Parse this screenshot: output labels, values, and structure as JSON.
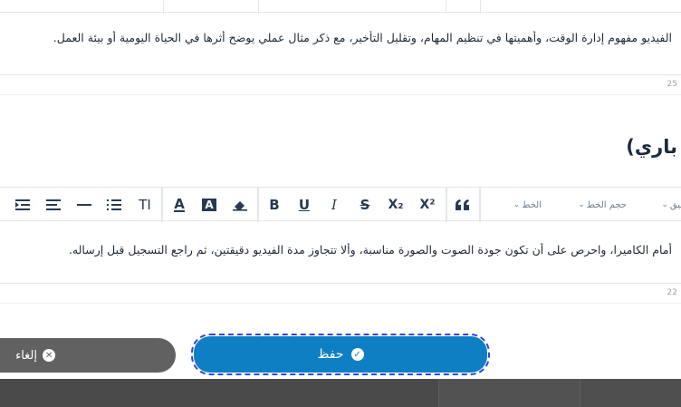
{
  "editor_top": {
    "text": "الفيديو مفهوم إدارة الوقت، وأهميتها في تنظيم المهام، وتقليل التأخير، مع ذكر مثال عملي يوضح أثرها في الحياة اليومية أو بيئة العمل.",
    "char_count": "25"
  },
  "section": {
    "title": "باري)"
  },
  "toolbar": {
    "format_dropdown": "تنسيق",
    "font_size_dropdown": "حجم الخط",
    "font_dropdown": "الخط",
    "quote_icon": "quote-icon",
    "superscript_label": "X²",
    "subscript_label": "X₂",
    "strike_label": "S",
    "italic_label": "I",
    "underline_label": "U",
    "bold_label": "B",
    "eraser_icon": "eraser-icon",
    "highlight_label": "A",
    "text_color_label": "A",
    "text_size_label": "TI"
  },
  "editor_bottom": {
    "text": "أمام الكاميرا، واحرص على أن تكون جودة الصوت والصورة مناسبة، وألا تتجاوز مدة الفيديو دقيقتين، ثم راجع التسجيل قبل إرساله.",
    "char_count": "22"
  },
  "actions": {
    "save_label": "حفظ",
    "cancel_label": "إلغاء"
  },
  "colors": {
    "save_button": "#0f7fc3",
    "cancel_button": "#616161",
    "focus_outline": "#2f44e0",
    "toolbar_icons": "#263b52"
  }
}
